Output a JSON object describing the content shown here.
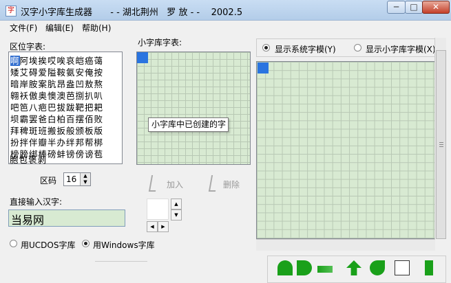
{
  "window": {
    "title": "汉字小字库生成器",
    "subtitle": "  - - 湖北荆州   罗 放 - -    2002.5",
    "controls": {
      "minimize": "─",
      "maximize": "□",
      "close": "✕"
    }
  },
  "menu": [
    "文件(F)",
    "编辑(E)",
    "帮助(H)"
  ],
  "left": {
    "charlist_label": "区位字表:",
    "char_rows": [
      "啊阿埃挨哎唉哀皑癌蔼",
      "矮艾碍爱隘鞍氨安俺按",
      "暗岸胺案肮昂盎凹敖熬",
      "翱袄傲奥懊澳芭捌扒叭",
      "吧笆八疤巴拔跋靶把耙",
      "坝霸罢爸白柏百摆佰败",
      "拜稗斑班搬扳般颁板版",
      "扮拌伴瓣半办绊邦帮梆",
      "榜膀绑棒磅蚌镑傍谤苞",
      "胞包褒剥"
    ],
    "selected_char": "啊",
    "qu_label": "区码",
    "qu_value": "16",
    "input_label": "直接输入汉字:",
    "input_value": "当易网",
    "radio_ucdos": "用UCDOS字库",
    "radio_windows": "用Windows字库"
  },
  "middle": {
    "grid_label": "小字库字表:",
    "tooltip": "小字库中已创建的字",
    "add_label": "加入",
    "delete_label": "删除"
  },
  "right": {
    "radio_system": "显示系统字模(Y)",
    "radio_small": "显示小字库字模(X)"
  }
}
